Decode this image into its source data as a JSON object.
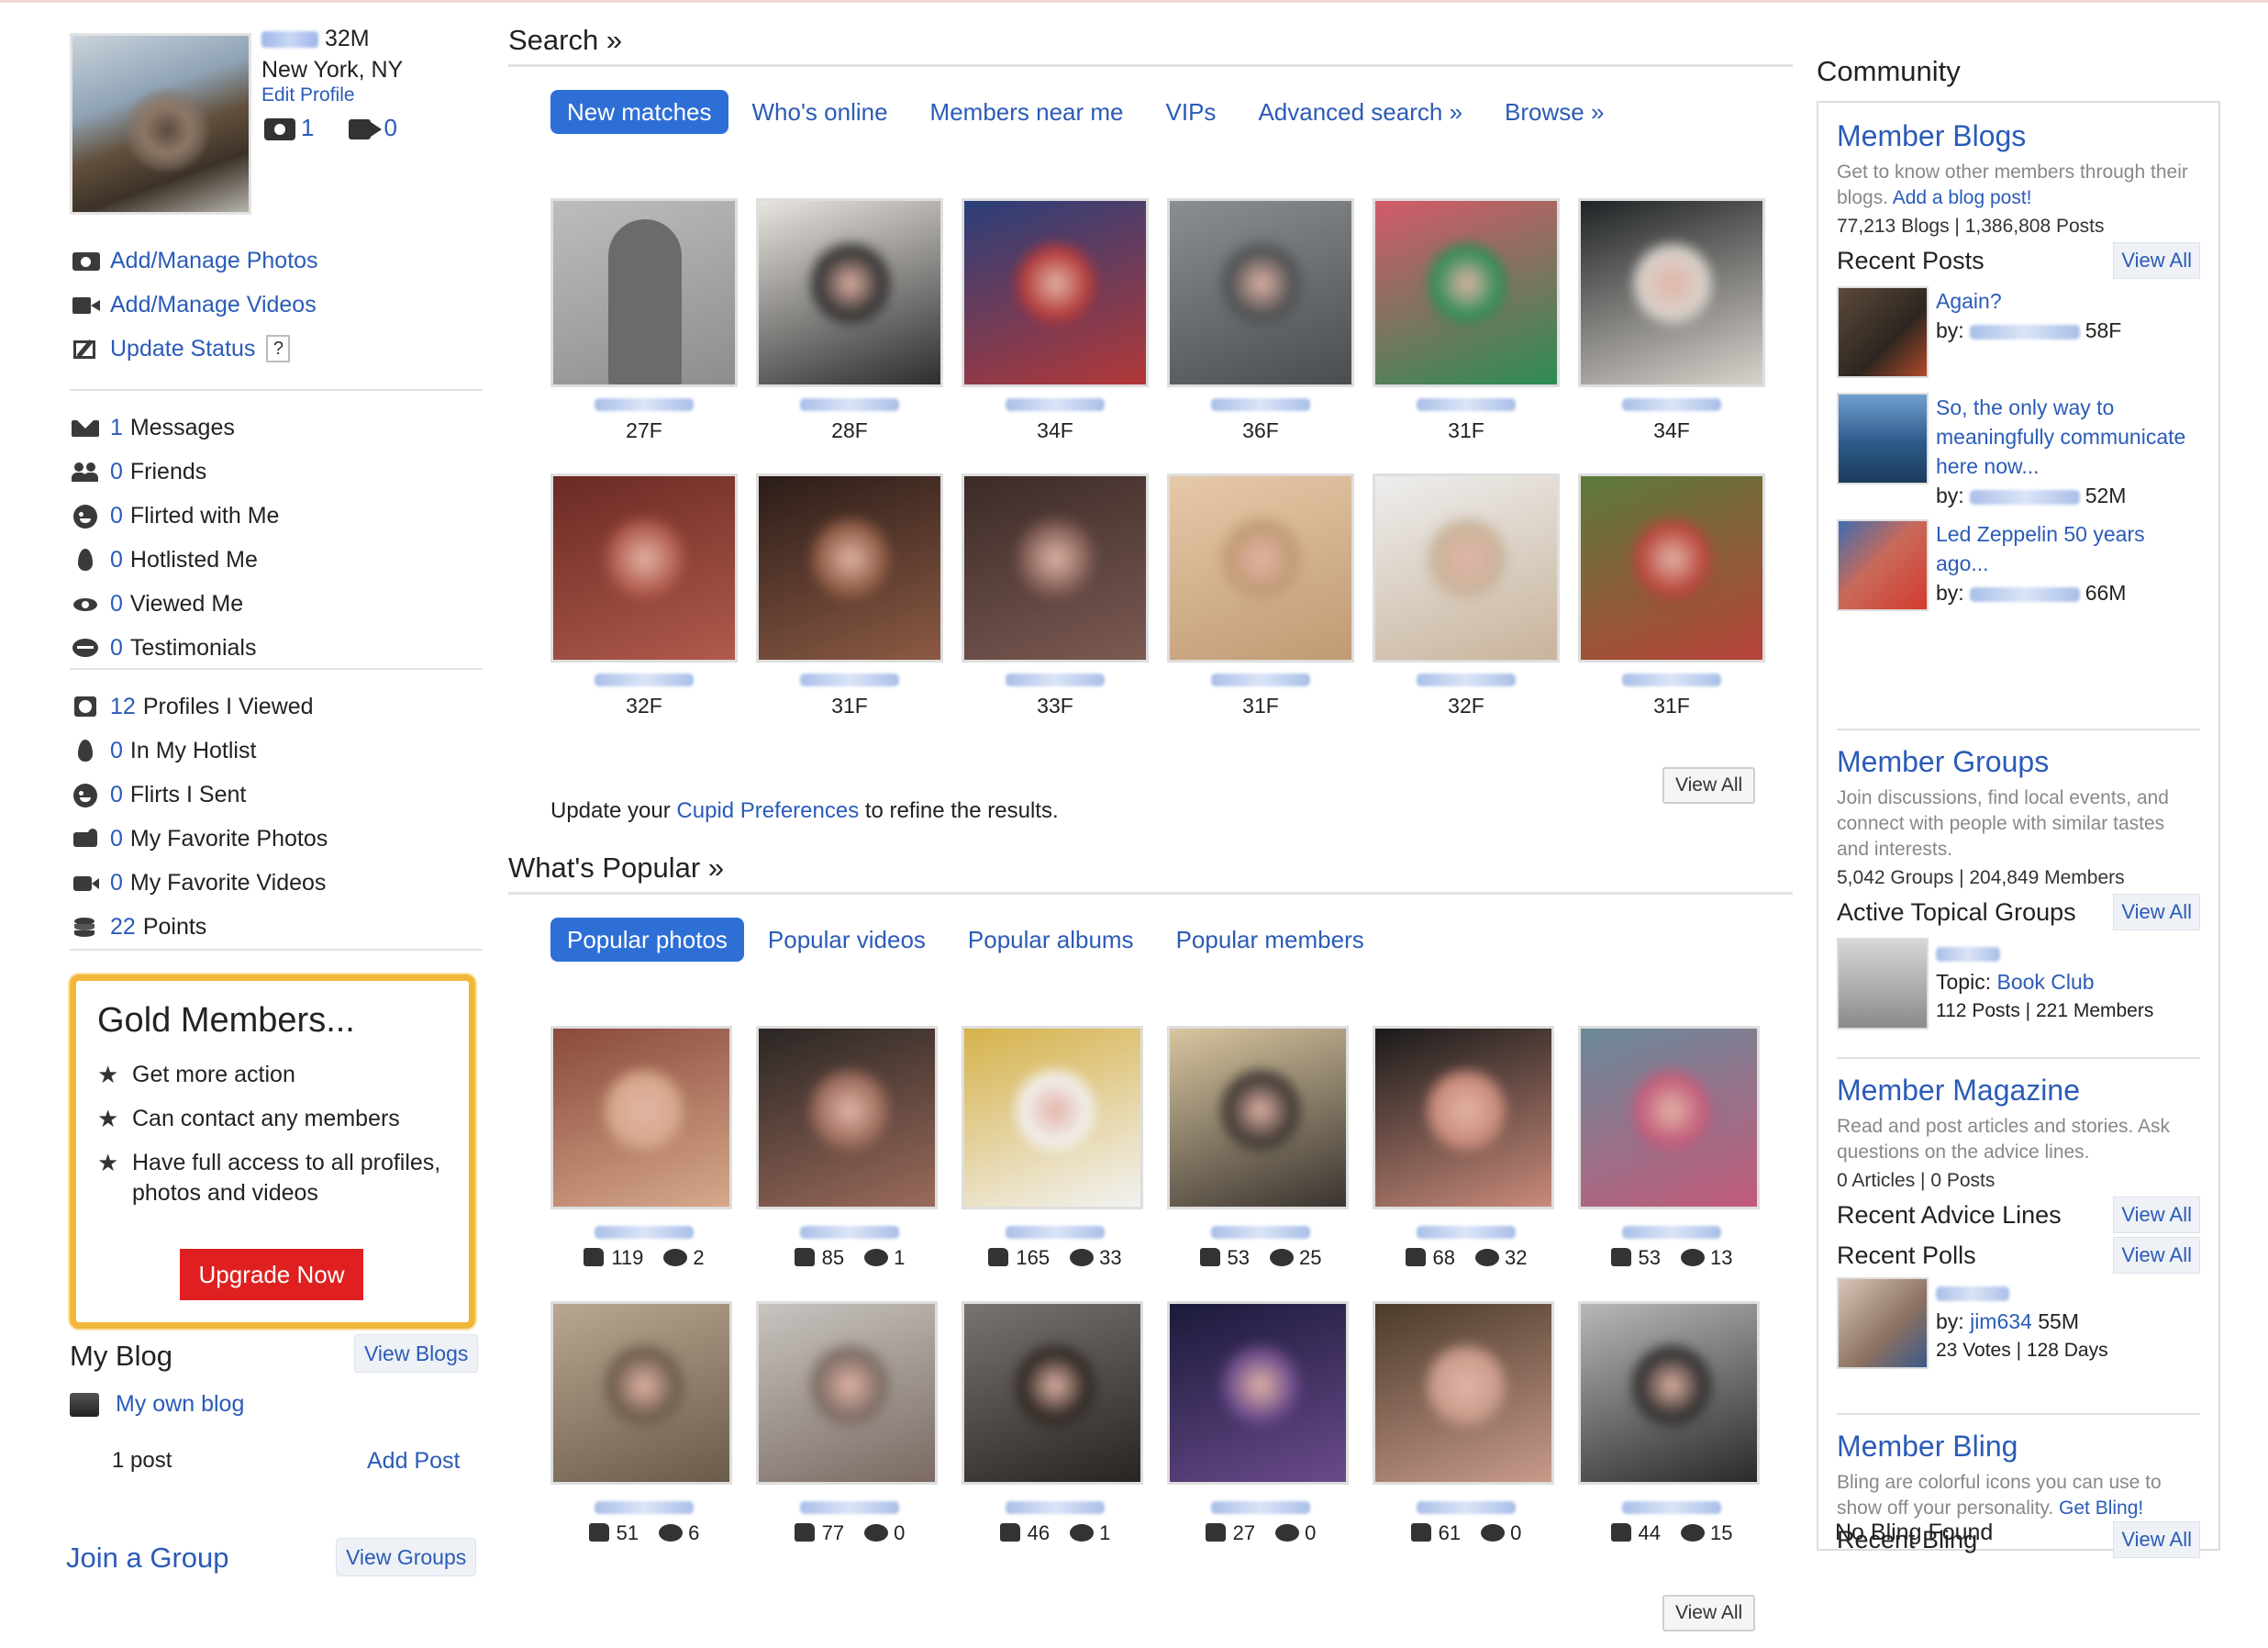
{
  "profile": {
    "age_sex": "32M",
    "location": "New York, NY",
    "edit": "Edit Profile",
    "photo_count": "1",
    "video_count": "0"
  },
  "left_links": {
    "actions": [
      {
        "label": "Add/Manage Photos"
      },
      {
        "label": "Add/Manage Videos"
      },
      {
        "label": "Update Status",
        "help": "?"
      }
    ],
    "inbox": [
      {
        "count": "1",
        "label": "Messages"
      },
      {
        "count": "0",
        "label": "Friends"
      },
      {
        "count": "0",
        "label": "Flirted with Me"
      },
      {
        "count": "0",
        "label": "Hotlisted Me"
      },
      {
        "count": "0",
        "label": "Viewed Me"
      },
      {
        "count": "0",
        "label": "Testimonials"
      }
    ],
    "activity": [
      {
        "count": "12",
        "label": "Profiles I Viewed"
      },
      {
        "count": "0",
        "label": "In My Hotlist"
      },
      {
        "count": "0",
        "label": "Flirts I Sent"
      },
      {
        "count": "0",
        "label": "My Favorite Photos"
      },
      {
        "count": "0",
        "label": "My Favorite Videos"
      },
      {
        "count": "22",
        "label": "Points"
      }
    ]
  },
  "gold": {
    "title": "Gold Members...",
    "items": [
      "Get more action",
      "Can contact any members",
      "Have full access to all profiles, photos and videos"
    ],
    "cta": "Upgrade Now"
  },
  "blog": {
    "title": "My Blog",
    "view": "View Blogs",
    "link": "My own blog",
    "posts": "1 post",
    "add": "Add Post"
  },
  "group": {
    "title": "Join a Group",
    "view": "View Groups"
  },
  "search": {
    "title": "Search »",
    "tabs": [
      "New matches",
      "Who's online",
      "Members near me",
      "VIPs",
      "Advanced search »",
      "Browse »"
    ],
    "results": [
      "27F",
      "28F",
      "34F",
      "36F",
      "31F",
      "34F",
      "32F",
      "31F",
      "33F",
      "31F",
      "32F",
      "31F"
    ],
    "view_all": "View All",
    "update_prefix": "Update your ",
    "update_link": "Cupid Preferences",
    "update_suffix": " to refine the results."
  },
  "popular": {
    "title": "What's Popular »",
    "tabs": [
      "Popular photos",
      "Popular videos",
      "Popular albums",
      "Popular members"
    ],
    "items": [
      {
        "likes": "119",
        "comments": "2"
      },
      {
        "likes": "85",
        "comments": "1"
      },
      {
        "likes": "165",
        "comments": "33"
      },
      {
        "likes": "53",
        "comments": "25"
      },
      {
        "likes": "68",
        "comments": "32"
      },
      {
        "likes": "53",
        "comments": "13"
      },
      {
        "likes": "51",
        "comments": "6"
      },
      {
        "likes": "77",
        "comments": "0"
      },
      {
        "likes": "46",
        "comments": "1"
      },
      {
        "likes": "27",
        "comments": "0"
      },
      {
        "likes": "61",
        "comments": "0"
      },
      {
        "likes": "44",
        "comments": "15"
      }
    ],
    "view_all": "View All"
  },
  "community": {
    "title": "Community",
    "blogs": {
      "title": "Member Blogs",
      "desc": "Get to know other members through their blogs. ",
      "desc_link": "Add a blog post!",
      "stats": "77,213 Blogs | 1,386,808 Posts",
      "recent": "Recent Posts",
      "view_all": "View All",
      "posts": [
        {
          "title": "Again?",
          "by": "by:",
          "meta": "58F"
        },
        {
          "title": "So, the only way to meaningfully communicate here now...",
          "by": "by:",
          "meta": "52M"
        },
        {
          "title": "Led Zeppelin 50 years ago...",
          "by": "by:",
          "meta": "66M"
        }
      ]
    },
    "groups": {
      "title": "Member Groups",
      "desc": "Join discussions, find local events, and connect with people with similar tastes and interests.",
      "stats": "5,042 Groups | 204,849 Members",
      "recent": "Active Topical Groups",
      "view_all": "View All",
      "topic_label": "Topic: ",
      "topic": "Book Club",
      "topic_stats": "112 Posts | 221 Members"
    },
    "magazine": {
      "title": "Member Magazine",
      "desc": "Read and post articles and stories. Ask questions on the advice lines.",
      "stats": "0 Articles | 0 Posts",
      "advice": "Recent Advice Lines",
      "polls": "Recent Polls",
      "view_all": "View All",
      "poll_by": "by: ",
      "poll_user": "jim634",
      "poll_user_meta": " 55M",
      "poll_stats": "23 Votes | 128 Days"
    },
    "bling": {
      "title": "Member Bling",
      "desc": "Bling are colorful icons you can use to show off your personality. ",
      "desc_link": "Get Bling!",
      "recent": "Recent Bling",
      "view_all": "View All",
      "empty": "No Bling Found"
    }
  }
}
